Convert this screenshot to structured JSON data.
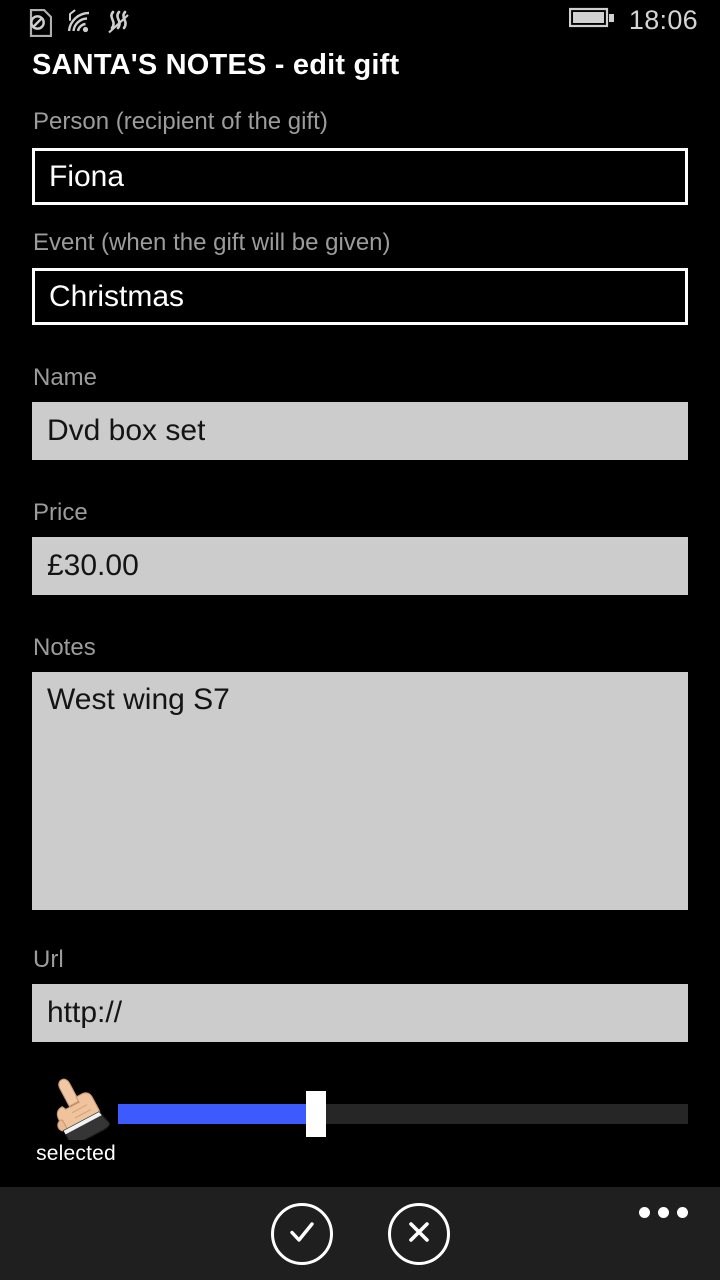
{
  "statusbar": {
    "icons": [
      {
        "name": "sim-card-blocked-icon",
        "label": "no SIM"
      },
      {
        "name": "wifi-signal-icon",
        "label": "wifi"
      },
      {
        "name": "cellular-signal-icon",
        "label": "cellular"
      }
    ],
    "battery": {
      "name": "battery-full-icon",
      "label": "battery"
    },
    "time": "18:06"
  },
  "header": {
    "title": "SANTA'S NOTES - edit gift"
  },
  "form": {
    "fields": [
      {
        "key": "person",
        "label": "Person (recipient of the gift)",
        "value": "Fiona",
        "style": "outline"
      },
      {
        "key": "event",
        "label": "Event (when the gift will be given)",
        "value": "Christmas",
        "style": "outline"
      },
      {
        "key": "name",
        "label": "Name",
        "value": "Dvd box set",
        "style": "filled"
      },
      {
        "key": "price",
        "label": "Price",
        "value": "£30.00",
        "style": "filled"
      },
      {
        "key": "notes",
        "label": "Notes",
        "value": "West wing S7",
        "style": "filled-multiline"
      },
      {
        "key": "url",
        "label": "Url",
        "value": "http://",
        "style": "filled"
      }
    ]
  },
  "cursor": {
    "icon": "pointing-hand-cursor",
    "glyph": "☝",
    "label": "selected"
  },
  "slider": {
    "name": "scroll-slider",
    "value_percent": 33,
    "fill_color": "#3d5afe",
    "track_color": "#262626",
    "thumb_color": "#ffffff"
  },
  "appbar": {
    "background": "#1f1f1f",
    "buttons": [
      {
        "name": "save-button",
        "icon": "check-circle-icon",
        "label": "save"
      },
      {
        "name": "cancel-button",
        "icon": "close-circle-icon",
        "label": "cancel"
      }
    ],
    "more": {
      "name": "more-menu-button",
      "label": "more"
    }
  },
  "colors": {
    "background": "#000000",
    "label_text": "#9c9c9c",
    "field_fill": "#cccccc",
    "accent": "#3d5afe"
  }
}
